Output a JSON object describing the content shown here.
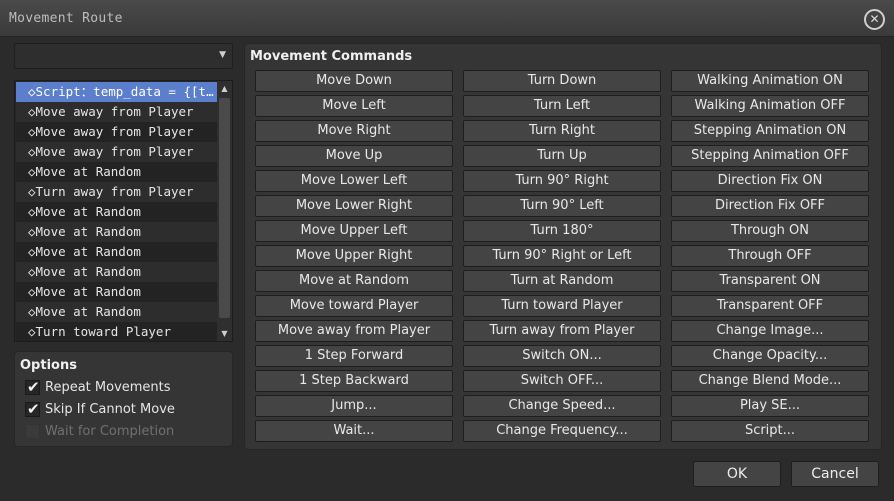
{
  "window": {
    "title": "Movement Route",
    "close_glyph": "✕"
  },
  "target_select": {
    "value": "",
    "arrow": "▼"
  },
  "route_list": {
    "items": [
      "◇Script：temp_data = {[t…",
      "◇Move away from Player",
      "◇Move away from Player",
      "◇Move away from Player",
      "◇Move at Random",
      "◇Turn away from Player",
      "◇Move at Random",
      "◇Move at Random",
      "◇Move at Random",
      "◇Move at Random",
      "◇Move at Random",
      "◇Move at Random",
      "◇Turn toward Player"
    ],
    "selected_index": 0,
    "scroll_up": "▲",
    "scroll_down": "▼"
  },
  "options": {
    "title": "Options",
    "items": [
      {
        "label": "Repeat Movements",
        "checked": true,
        "enabled": true
      },
      {
        "label": "Skip If Cannot Move",
        "checked": true,
        "enabled": true
      },
      {
        "label": "Wait for Completion",
        "checked": false,
        "enabled": false
      }
    ],
    "tick": "✔"
  },
  "commands": {
    "title": "Movement Commands",
    "columns": [
      [
        "Move Down",
        "Move Left",
        "Move Right",
        "Move Up",
        "Move Lower Left",
        "Move Lower Right",
        "Move Upper Left",
        "Move Upper Right",
        "Move at Random",
        "Move toward Player",
        "Move away from Player",
        "1 Step Forward",
        "1 Step Backward",
        "Jump...",
        "Wait..."
      ],
      [
        "Turn Down",
        "Turn Left",
        "Turn Right",
        "Turn Up",
        "Turn 90° Right",
        "Turn 90° Left",
        "Turn 180°",
        "Turn 90° Right or Left",
        "Turn at Random",
        "Turn toward Player",
        "Turn away from Player",
        "Switch ON...",
        "Switch OFF...",
        "Change Speed...",
        "Change Frequency..."
      ],
      [
        "Walking Animation ON",
        "Walking Animation OFF",
        "Stepping Animation ON",
        "Stepping Animation OFF",
        "Direction Fix ON",
        "Direction Fix OFF",
        "Through ON",
        "Through OFF",
        "Transparent ON",
        "Transparent OFF",
        "Change Image...",
        "Change Opacity...",
        "Change Blend Mode...",
        "Play SE...",
        "Script..."
      ]
    ]
  },
  "footer": {
    "ok_label": "OK",
    "cancel_label": "Cancel"
  }
}
